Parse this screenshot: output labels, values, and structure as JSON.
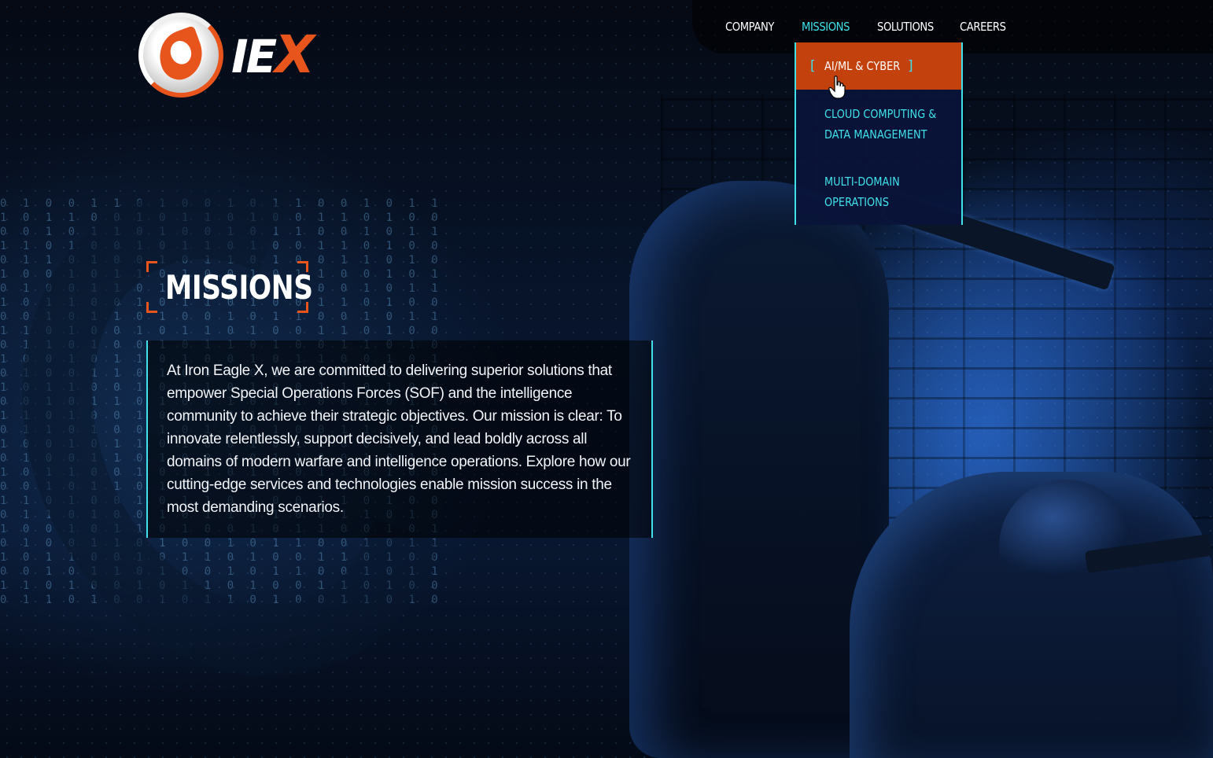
{
  "brand": {
    "logo_text_ie": "IE",
    "logo_text_x": "X",
    "accent_orange": "#e8551c",
    "accent_cyan": "#3fe0e8",
    "dropdown_active_bg": "#c2410c"
  },
  "nav": {
    "items": [
      {
        "label": "COMPANY"
      },
      {
        "label": "MISSIONS"
      },
      {
        "label": "SOLUTIONS"
      },
      {
        "label": "CAREERS"
      }
    ],
    "active": "MISSIONS"
  },
  "dropdown": {
    "items": [
      {
        "label": "AI/ML & CYBER",
        "bracket_left": "[",
        "bracket_right": "]"
      },
      {
        "label": "CLOUD COMPUTING &\nDATA MANAGEMENT"
      },
      {
        "label": "MULTI-DOMAIN\nOPERATIONS"
      }
    ],
    "hovered": "AI/ML & CYBER",
    "cursor_icon": "hand-pointer-icon"
  },
  "hero": {
    "title": "MISSIONS",
    "body": "At Iron Eagle X, we are committed to delivering superior solutions that empower Special Operations Forces (SOF) and the intelligence community to achieve their strategic objectives. Our mission is clear: To innovate relentlessly, support decisively, and lead boldly across all domains of modern warfare and intelligence operations. Explore how our cutting-edge services and technologies enable mission success in the most demanding scenarios."
  }
}
